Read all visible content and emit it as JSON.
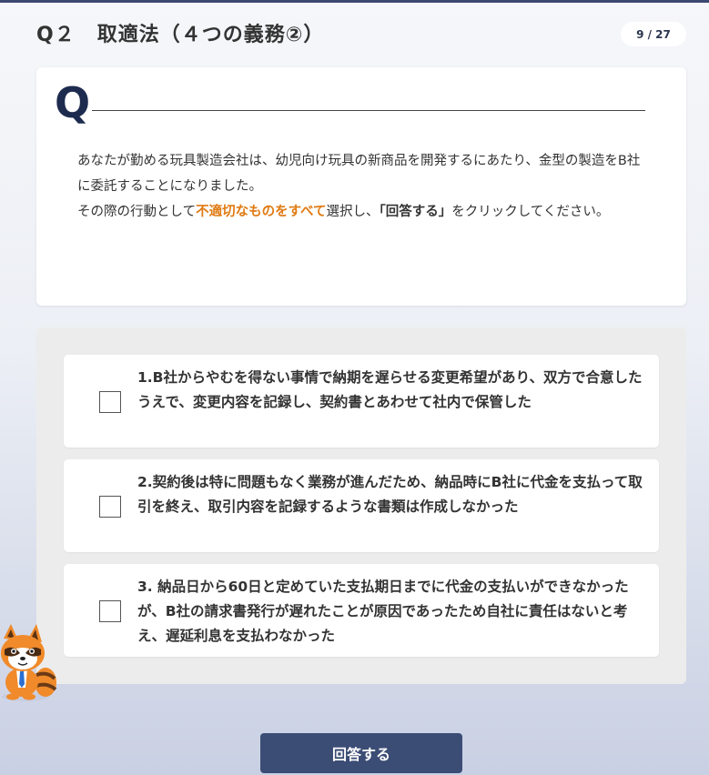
{
  "header": {
    "question_number": "Q２",
    "title": "取適法（４つの義務②）",
    "progress": "9 / 27"
  },
  "question": {
    "mark": "Q",
    "text_1": "あなたが勤める玩具製造会社は、幼児向け玩具の新商品を開発するにあたり、金型の製造をB社に委託することになりました。",
    "text_2_prefix": "その際の行動として",
    "text_2_highlight": "不適切なものをすべて",
    "text_2_middle": "選択し、",
    "text_2_button_ref": "「回答する」",
    "text_2_suffix": "をクリックしてください。"
  },
  "options": [
    {
      "text": "1.B社からやむを得ない事情で納期を遅らせる変更希望があり、双方で合意したうえで、変更内容を記録し、契約書とあわせて社内で保管した",
      "checked": false
    },
    {
      "text": "2.契約後は特に問題もなく業務が進んだため、納品時にB社に代金を支払って取引を終え、取引内容を記録するような書類は作成しなかった",
      "checked": false
    },
    {
      "text": "3. 納品日から60日と定めていた支払期日までに代金の支払いができなかったが、B社の請求書発行が遅れたことが原因であったため自社に責任はないと考え、遅延利息を支払わなかった",
      "checked": false
    }
  ],
  "submit_label": "回答する",
  "mascot_icon": "raccoon-mascot-icon",
  "colors": {
    "accent_dark": "#3b4c75",
    "highlight_orange": "#e07a12",
    "q_mark": "#1d2b4f"
  }
}
